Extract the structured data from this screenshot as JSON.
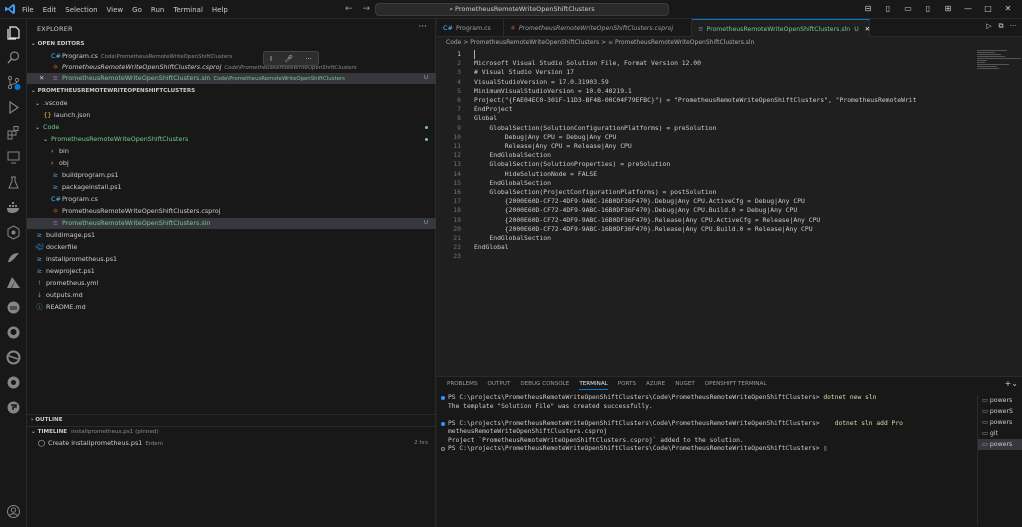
{
  "menu": [
    "File",
    "Edit",
    "Selection",
    "View",
    "Go",
    "Run",
    "Terminal",
    "Help"
  ],
  "command_center": "PrometheusRemoteWriteOpenShiftClusters",
  "sidebar": {
    "title": "EXPLORER",
    "open_editors_header": "OPEN EDITORS",
    "open_editors": [
      {
        "name": "Program.cs",
        "desc": "Code\\PrometheusRemoteWriteOpenShiftClusters",
        "icon": "csharp-icon"
      },
      {
        "name": "PrometheusRemoteWriteOpenShiftClusters.csproj",
        "desc": "Code\\PrometheusRemoteWriteOpenShiftClusters",
        "icon": "csproj-icon"
      },
      {
        "name": "PrometheusRemoteWriteOpenShiftClusters.sln",
        "desc": "Code\\PrometheusRemoteWriteOpenShiftClusters",
        "badge": "U",
        "icon": "sln-icon"
      }
    ],
    "workspace_header": "PROMETHEUSREMOTEWRITEOPENSHIFTCLUSTERS",
    "tree": [
      {
        "label": ".vscode",
        "kind": "folder-open",
        "indent": 1
      },
      {
        "label": "launch.json",
        "kind": "json",
        "indent": 2
      },
      {
        "label": "Code",
        "kind": "folder-open",
        "indent": 1
      },
      {
        "label": "PrometheusRemoteWriteOpenShiftClusters",
        "kind": "folder-open",
        "indent": 2
      },
      {
        "label": "bin",
        "kind": "folder",
        "indent": 3
      },
      {
        "label": "obj",
        "kind": "folder",
        "indent": 3
      },
      {
        "label": "buildprogram.ps1",
        "kind": "ps1",
        "indent": 3
      },
      {
        "label": "packageinstall.ps1",
        "kind": "ps1",
        "indent": 3
      },
      {
        "label": "Program.cs",
        "kind": "cs",
        "indent": 3
      },
      {
        "label": "PrometheusRemoteWriteOpenShiftClusters.csproj",
        "kind": "csproj",
        "indent": 3
      },
      {
        "label": "PrometheusRemoteWriteOpenShiftClusters.sln",
        "kind": "sln",
        "indent": 3,
        "badge": "U"
      },
      {
        "label": "buildimage.ps1",
        "kind": "ps1",
        "indent": 1
      },
      {
        "label": "dockerfile",
        "kind": "docker",
        "indent": 1
      },
      {
        "label": "installprometheus.ps1",
        "kind": "ps1",
        "indent": 1
      },
      {
        "label": "newproject.ps1",
        "kind": "ps1",
        "indent": 1
      },
      {
        "label": "prometheus.yml",
        "kind": "yml",
        "indent": 1
      },
      {
        "label": "outputs.md",
        "kind": "md",
        "indent": 1
      },
      {
        "label": "README.md",
        "kind": "info",
        "indent": 1
      }
    ],
    "outline_header": "OUTLINE",
    "timeline_header": "TIMELINE",
    "timeline_desc": "installprometheus.ps1 (pinned)",
    "timeline_entry": {
      "label": "Create installprometheus.ps1",
      "author": "Erdem",
      "time": "2 hrs"
    }
  },
  "tabs": [
    {
      "label": "Program.cs",
      "icon": "C#"
    },
    {
      "label": "PrometheusRemoteWriteOpenShiftClusters.csproj",
      "icon": "⚛"
    },
    {
      "label": "PrometheusRemoteWriteOpenShiftClusters.sln",
      "icon": "≡",
      "badge": "U"
    }
  ],
  "breadcrumb": {
    "parts": [
      "Code",
      "PrometheusRemoteWriteOpenShiftClusters",
      "PrometheusRemoteWriteOpenShiftClusters.sln"
    ],
    "sep": ">"
  },
  "code_lines": [
    "",
    "Microsoft Visual Studio Solution File, Format Version 12.00",
    "# Visual Studio Version 17",
    "VisualStudioVersion = 17.0.31903.59",
    "MinimumVisualStudioVersion = 10.0.40219.1",
    "Project(\"{FAE04EC0-301F-11D3-BF4B-00C04F79EFBC}\") = \"PrometheusRemoteWriteOpenShiftClusters\", \"PrometheusRemoteWrit",
    "EndProject",
    "Global",
    "    GlobalSection(SolutionConfigurationPlatforms) = preSolution",
    "        Debug|Any CPU = Debug|Any CPU",
    "        Release|Any CPU = Release|Any CPU",
    "    EndGlobalSection",
    "    GlobalSection(SolutionProperties) = preSolution",
    "        HideSolutionNode = FALSE",
    "    EndGlobalSection",
    "    GlobalSection(ProjectConfigurationPlatforms) = postSolution",
    "        {2000E60D-CF72-4DF9-9ABC-16B0DF36F470}.Debug|Any CPU.ActiveCfg = Debug|Any CPU",
    "        {2000E60D-CF72-4DF9-9ABC-16B0DF36F470}.Debug|Any CPU.Build.0 = Debug|Any CPU",
    "        {2000E60D-CF72-4DF9-9ABC-16B0DF36F470}.Release|Any CPU.ActiveCfg = Release|Any CPU",
    "        {2000E60D-CF72-4DF9-9ABC-16B0DF36F470}.Release|Any CPU.Build.0 = Release|Any CPU",
    "    EndGlobalSection",
    "EndGlobal",
    ""
  ],
  "panel": {
    "tabs": [
      "PROBLEMS",
      "OUTPUT",
      "DEBUG CONSOLE",
      "TERMINAL",
      "PORTS",
      "AZURE",
      "NUGET",
      "OPENSHIFT TERMINAL"
    ],
    "active_tab": "TERMINAL",
    "terminal_lines": [
      {
        "bullet": "blue",
        "prompt": "PS C:\\projects\\PrometheusRemoteWriteOpenShiftClusters\\Code\\PrometheusRemoteWriteOpenShiftClusters> ",
        "cmd": "dotnet new sln"
      },
      {
        "bullet": "",
        "prompt": "The template \"Solution File\" was created successfully.",
        "cmd": ""
      },
      {
        "bullet": "",
        "prompt": "",
        "cmd": ""
      },
      {
        "bullet": "blue",
        "prompt": "PS C:\\projects\\PrometheusRemoteWriteOpenShiftClusters\\Code\\PrometheusRemoteWriteOpenShiftClusters>    ",
        "cmd": "dotnet sln add Pro"
      },
      {
        "bullet": "",
        "prompt": "metheusRemoteWriteOpenShiftClusters.csproj",
        "cmd": ""
      },
      {
        "bullet": "",
        "prompt": "Project `PrometheusRemoteWriteOpenShiftClusters.csproj` added to the solution.",
        "cmd": ""
      },
      {
        "bullet": "hollow",
        "prompt": "PS C:\\projects\\PrometheusRemoteWriteOpenShiftClusters\\Code\\PrometheusRemoteWriteOpenShiftClusters> ▯",
        "cmd": ""
      }
    ],
    "terminal_list": [
      "powers",
      "powerS",
      "powers",
      "git",
      "powers"
    ]
  },
  "colors": {
    "accent": "#0078d4",
    "untracked": "#73c991",
    "csharp": "#4fc1ff",
    "powershell": "#569cd6",
    "folder": "#c5c5c5"
  }
}
